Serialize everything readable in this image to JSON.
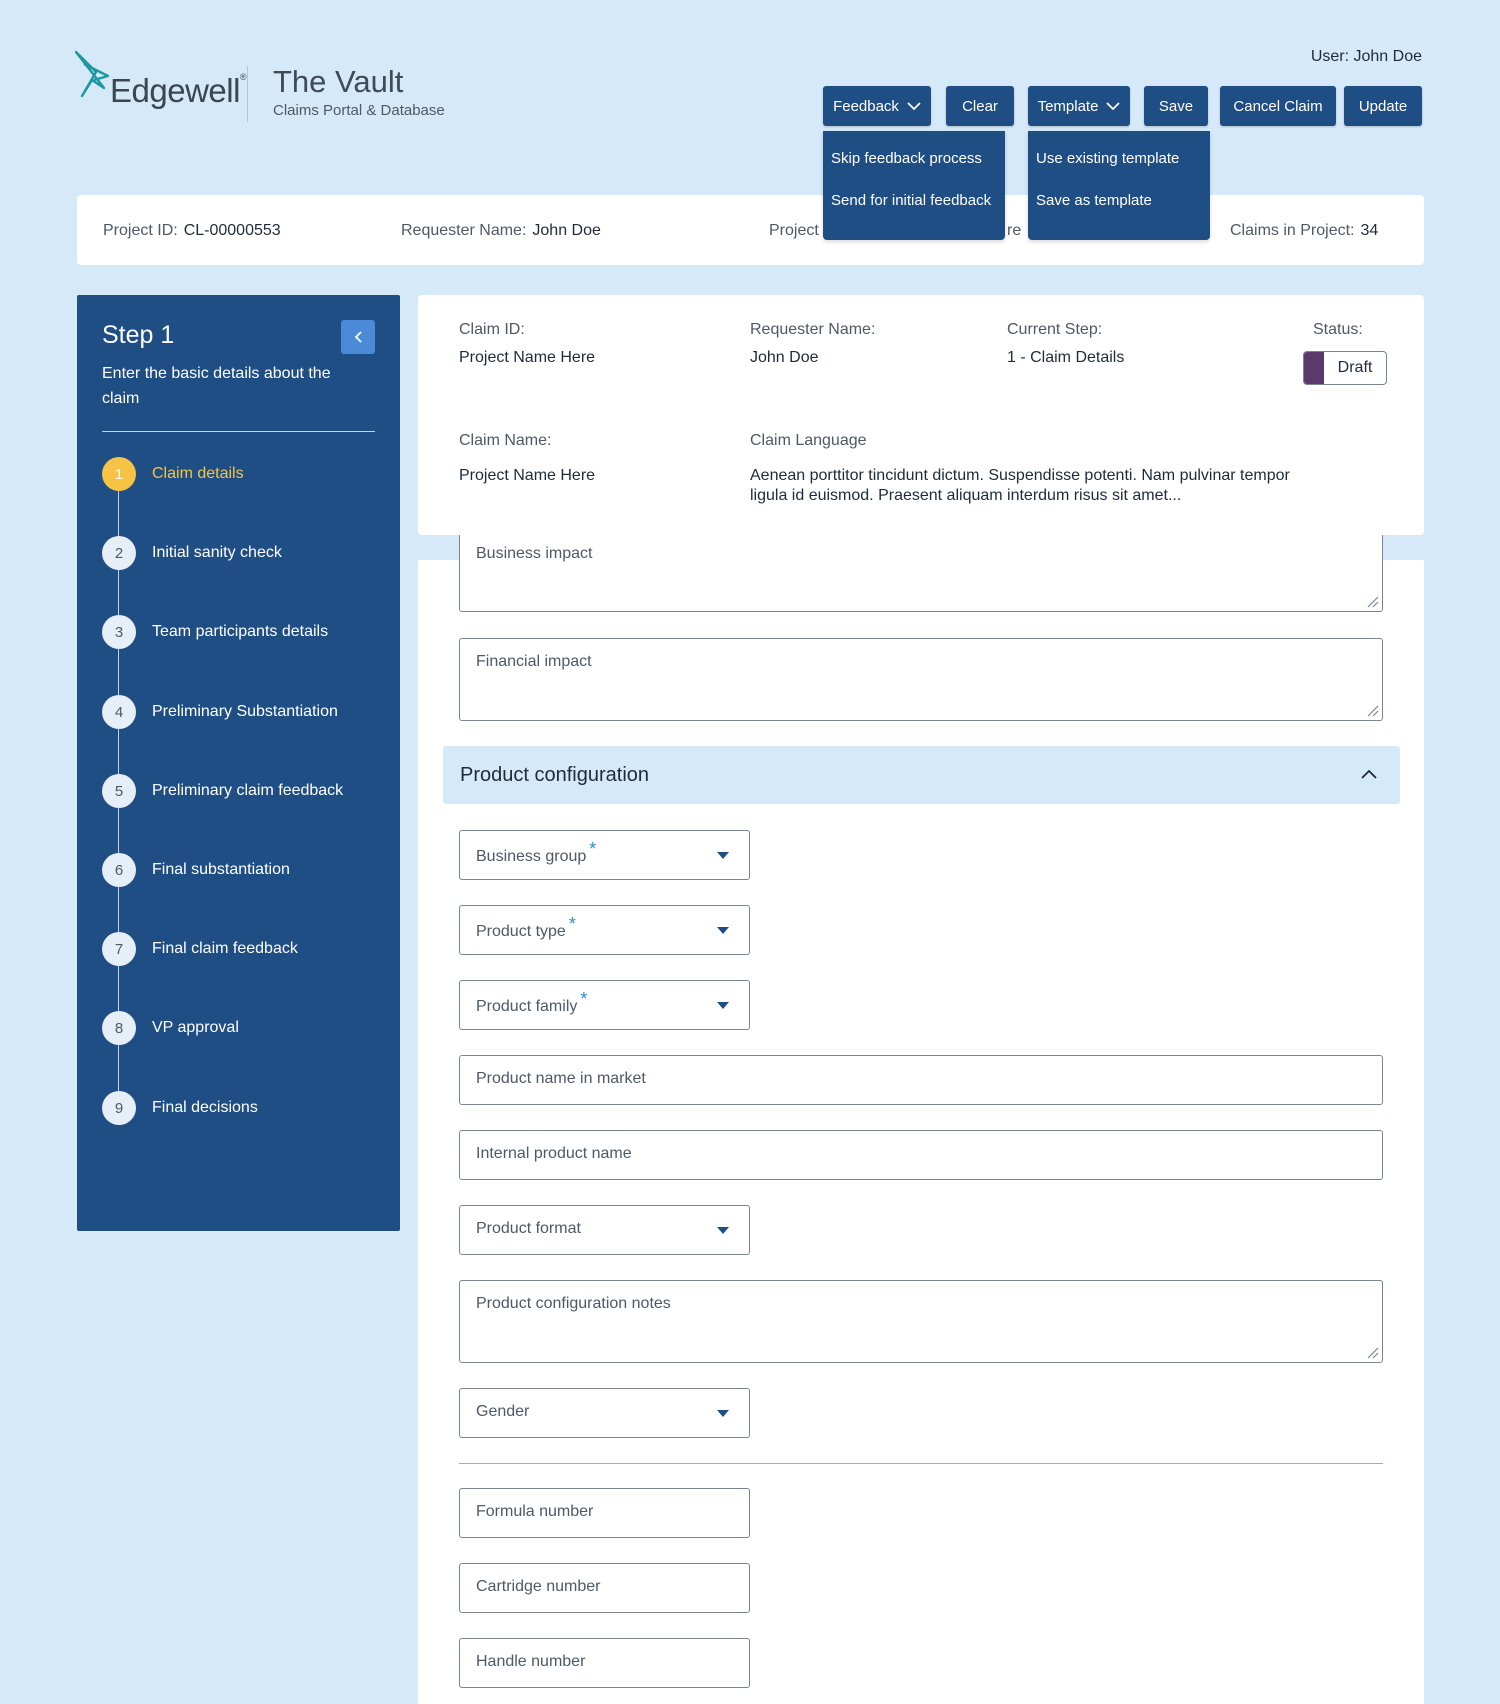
{
  "header": {
    "logo_text": "Edgewell",
    "app_title": "The Vault",
    "app_subtitle": "Claims Portal & Database",
    "user_label": "User: John Doe"
  },
  "toolbar": {
    "feedback": "Feedback",
    "clear": "Clear",
    "template": "Template",
    "save": "Save",
    "cancel_claim": "Cancel Claim",
    "update": "Update"
  },
  "feedback_menu": [
    "Skip feedback process",
    "Send for initial feedback"
  ],
  "template_menu": [
    "Use existing template",
    "Save as template"
  ],
  "project_bar": {
    "project_id_label": "Project ID:",
    "project_id_value": "CL-00000553",
    "requester_label": "Requester Name:",
    "requester_value": "John Doe",
    "project_partial_left": "Project",
    "project_partial_right": "re",
    "claims_label": "Claims in Project:",
    "claims_value": "34"
  },
  "sidebar": {
    "step_title": "Step 1",
    "step_desc": "Enter the basic details about the claim",
    "steps": [
      {
        "num": "1",
        "label": "Claim details"
      },
      {
        "num": "2",
        "label": "Initial sanity check"
      },
      {
        "num": "3",
        "label": "Team participants details"
      },
      {
        "num": "4",
        "label": "Preliminary Substantiation"
      },
      {
        "num": "5",
        "label": "Preliminary claim feedback"
      },
      {
        "num": "6",
        "label": "Final substantiation"
      },
      {
        "num": "7",
        "label": "Final claim feedback"
      },
      {
        "num": "8",
        "label": "VP approval"
      },
      {
        "num": "9",
        "label": "Final decisions"
      }
    ],
    "active_step": 1
  },
  "claim_card": {
    "claim_id_label": "Claim ID:",
    "claim_id_value": "Project Name Here",
    "requester_label": "Requester Name:",
    "requester_value": "John Doe",
    "current_step_label": "Current Step:",
    "current_step_value": "1 - Claim Details",
    "status_label": "Status:",
    "status_value": "Draft",
    "claim_name_label": "Claim Name:",
    "claim_name_value": "Project Name Here",
    "claim_language_label": "Claim Language",
    "claim_language_value": "Aenean porttitor tincidunt dictum. Suspendisse potenti. Nam pulvinar tempor ligula id euismod. Praesent aliquam interdum risus sit amet..."
  },
  "form": {
    "business_impact": "Business impact",
    "financial_impact": "Financial impact",
    "section_title": "Product configuration",
    "business_group": "Business group",
    "product_type": "Product type",
    "product_family": "Product family",
    "required_mark": "*",
    "product_name_market": "Product name in market",
    "internal_product_name": "Internal product name",
    "product_format": "Product format",
    "product_config_notes": "Product configuration notes",
    "gender": "Gender",
    "formula_number": "Formula number",
    "cartridge_number": "Cartridge number",
    "handle_number": "Handle number"
  },
  "colors": {
    "background": "#d6e9f9",
    "primary": "#1f4e85",
    "accent_active": "#f6c344",
    "status_draft": "#5a3a6b",
    "required": "#2d8fc4"
  }
}
